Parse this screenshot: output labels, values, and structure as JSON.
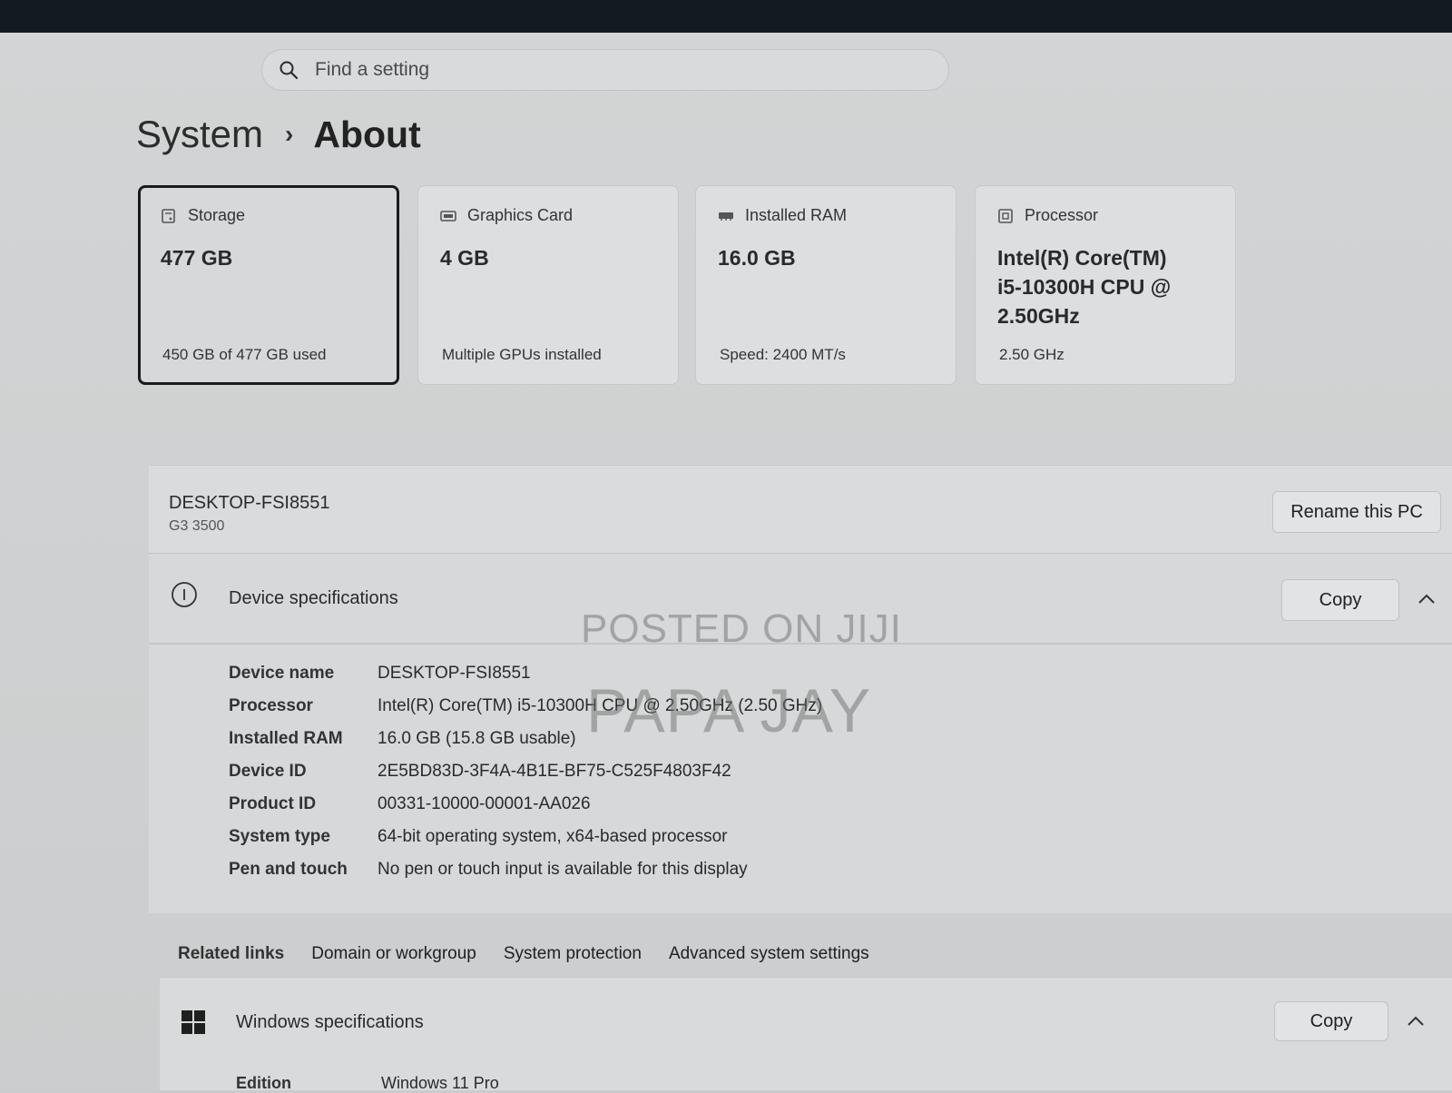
{
  "search": {
    "placeholder": "Find a setting"
  },
  "breadcrumb": {
    "parent": "System",
    "separator": "›",
    "current": "About"
  },
  "cards": [
    {
      "icon": "storage-icon",
      "title": "Storage",
      "value": "477 GB",
      "sub": "450 GB of 477 GB used"
    },
    {
      "icon": "graphics-card-icon",
      "title": "Graphics Card",
      "value": "4 GB",
      "sub": "Multiple GPUs installed"
    },
    {
      "icon": "ram-icon",
      "title": "Installed RAM",
      "value": "16.0 GB",
      "sub": "Speed: 2400 MT/s"
    },
    {
      "icon": "processor-icon",
      "title": "Processor",
      "value": "Intel(R) Core(TM) i5-10300H CPU @ 2.50GHz",
      "sub": "2.50 GHz"
    }
  ],
  "pc": {
    "name": "DESKTOP-FSI8551",
    "model": "G3 3500",
    "rename_label": "Rename this PC"
  },
  "device_specs": {
    "title": "Device specifications",
    "copy_label": "Copy",
    "rows": [
      {
        "label": "Device name",
        "value": "DESKTOP-FSI8551"
      },
      {
        "label": "Processor",
        "value": "Intel(R) Core(TM) i5-10300H CPU @ 2.50GHz (2.50 GHz)"
      },
      {
        "label": "Installed RAM",
        "value": "16.0 GB (15.8 GB usable)"
      },
      {
        "label": "Device ID",
        "value": "2E5BD83D-3F4A-4B1E-BF75-C525F4803F42"
      },
      {
        "label": "Product ID",
        "value": "00331-10000-00001-AA026"
      },
      {
        "label": "System type",
        "value": "64-bit operating system, x64-based processor"
      },
      {
        "label": "Pen and touch",
        "value": "No pen or touch input is available for this display"
      }
    ]
  },
  "related_links": {
    "label": "Related links",
    "links": [
      "Domain or workgroup",
      "System protection",
      "Advanced system settings"
    ]
  },
  "windows_specs": {
    "title": "Windows specifications",
    "copy_label": "Copy",
    "rows": [
      {
        "label": "Edition",
        "value": "Windows 11 Pro"
      }
    ]
  },
  "watermark": {
    "line1": "POSTED ON JIJI",
    "line2": "PAPA JAY"
  }
}
